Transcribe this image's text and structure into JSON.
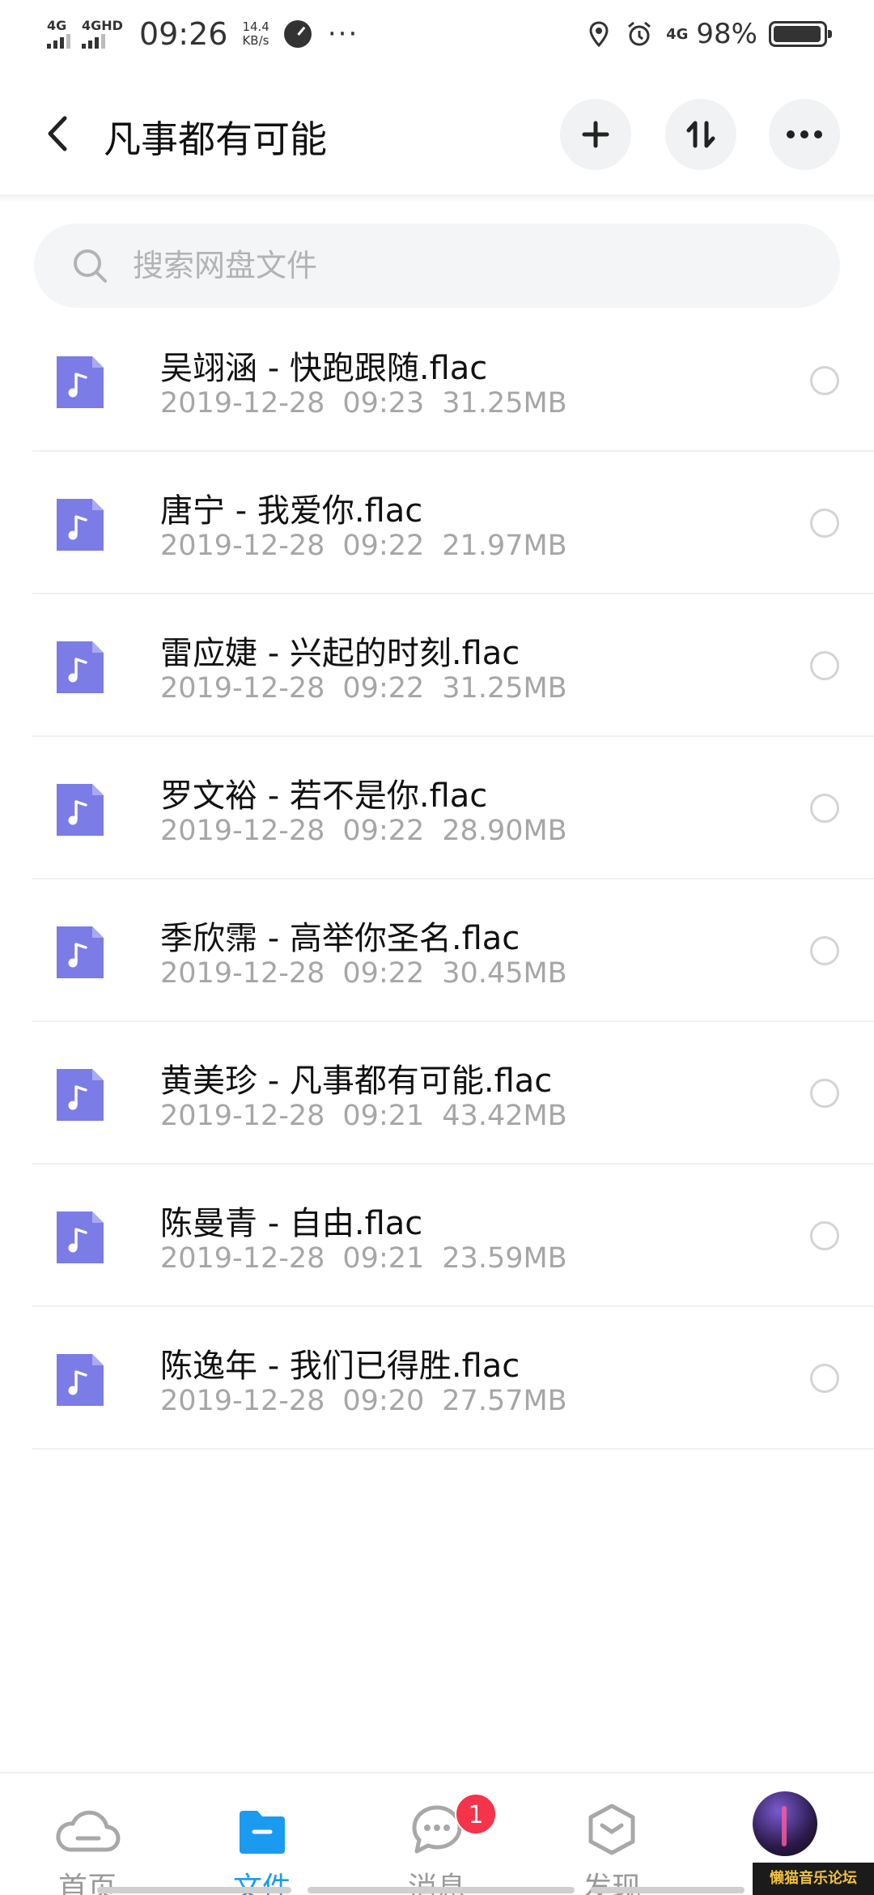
{
  "status_bar": {
    "sim1": "4G",
    "sim2": "4GHD",
    "time": "09:26",
    "speed_value": "14.4",
    "speed_unit": "KB/s",
    "more": "···",
    "network": "4G",
    "battery": "98%"
  },
  "header": {
    "title": "凡事都有可能"
  },
  "search": {
    "placeholder": "搜索网盘文件"
  },
  "files": [
    {
      "name": "吴翊涵 - 快跑跟随.flac",
      "date": "2019-12-28",
      "time": "09:23",
      "size": "31.25MB"
    },
    {
      "name": "唐宁 - 我爱你.flac",
      "date": "2019-12-28",
      "time": "09:22",
      "size": "21.97MB"
    },
    {
      "name": "雷应婕 - 兴起的时刻.flac",
      "date": "2019-12-28",
      "time": "09:22",
      "size": "31.25MB"
    },
    {
      "name": "罗文裕 - 若不是你.flac",
      "date": "2019-12-28",
      "time": "09:22",
      "size": "28.90MB"
    },
    {
      "name": "季欣霈 - 高举你圣名.flac",
      "date": "2019-12-28",
      "time": "09:22",
      "size": "30.45MB"
    },
    {
      "name": "黄美珍 - 凡事都有可能.flac",
      "date": "2019-12-28",
      "time": "09:21",
      "size": "43.42MB"
    },
    {
      "name": "陈曼青 - 自由.flac",
      "date": "2019-12-28",
      "time": "09:21",
      "size": "23.59MB"
    },
    {
      "name": "陈逸年 - 我们已得胜.flac",
      "date": "2019-12-28",
      "time": "09:20",
      "size": "27.57MB"
    }
  ],
  "bottom_nav": {
    "home": "首页",
    "files": "文件",
    "messages": "消息",
    "messages_badge": "1",
    "discover": "发现"
  },
  "watermark": "懒猫音乐论坛",
  "colors": {
    "accent": "#1a9bf0",
    "file_icon": "#7b7ce6",
    "badge": "#f5334a"
  }
}
